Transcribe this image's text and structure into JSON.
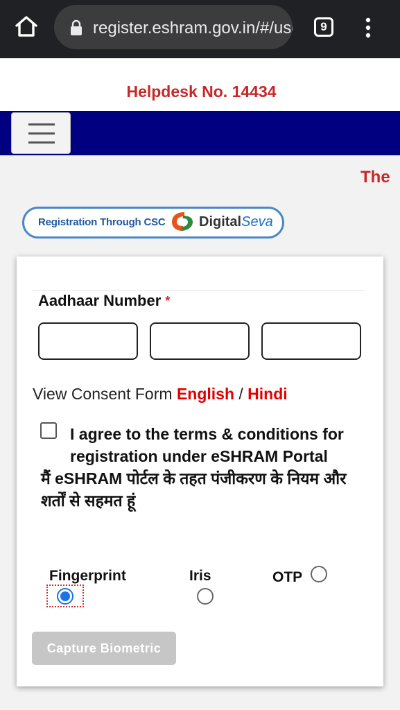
{
  "browser": {
    "url": "register.eshram.gov.in/#/user/self",
    "tab_count": "9",
    "icons": {
      "home": "home-icon",
      "lock": "lock-icon",
      "menu": "kebab-menu-icon"
    }
  },
  "header": {
    "helpdesk": "Helpdesk No. 14434",
    "marquee": "The"
  },
  "csc_banner": {
    "label": "Registration Through CSC",
    "brand_main": "Digital",
    "brand_accent": "Seva"
  },
  "form": {
    "aadhaar_label": "Aadhaar Number",
    "required_mark": "*",
    "aadhaar_fields": [
      "",
      "",
      ""
    ],
    "consent_prefix": "View Consent Form",
    "consent_english": "English",
    "consent_separator": "/",
    "consent_hindi": "Hindi",
    "agree_checked": false,
    "agree_text_en": "I agree to the terms & conditions for registration under eSHRAM Portal",
    "agree_text_hi": "मैं eSHRAM पोर्टल के तहत पंजीकरण के नियम और शर्तों से सहमत हूं",
    "auth_options": [
      {
        "label": "Fingerprint",
        "selected": true
      },
      {
        "label": "Iris",
        "selected": false
      },
      {
        "label": "OTP",
        "selected": false
      }
    ],
    "capture_button": "Capture Biometric"
  },
  "colors": {
    "browser_bg": "#202124",
    "helpdesk_red": "#c62828",
    "navbar_blue": "#000080",
    "link_red": "#e30000",
    "radio_blue": "#1a73e8",
    "button_disabled": "#c6c6c6"
  }
}
